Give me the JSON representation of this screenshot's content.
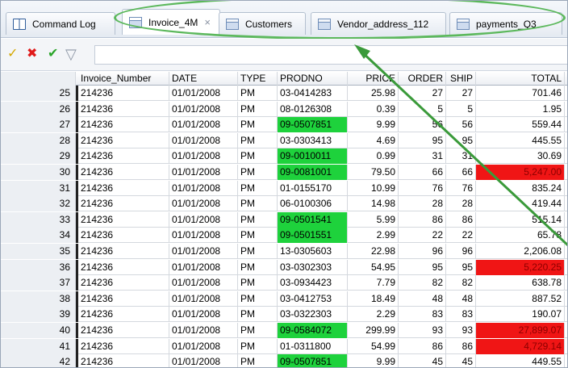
{
  "tabs": [
    {
      "label": "Command Log",
      "icon": "book-icon",
      "active": false
    },
    {
      "label": "Invoice_4M",
      "icon": "table-icon",
      "active": true,
      "close": "×"
    },
    {
      "label": "Customers",
      "icon": "table-icon",
      "active": false
    },
    {
      "label": "Vendor_address_112",
      "icon": "table-icon",
      "active": false
    },
    {
      "label": "payments_Q3",
      "icon": "table-icon",
      "active": false
    }
  ],
  "toolbar": {
    "icons": [
      "highlight-filter-icon",
      "delete-filter-icon",
      "apply-filter-icon",
      "funnel-icon"
    ],
    "filter_value": ""
  },
  "columns": [
    "Invoice_Number",
    "DATE",
    "TYPE",
    "PRODNO",
    "PRICE",
    "ORDER",
    "SHIP",
    "TOTAL"
  ],
  "rows": [
    {
      "n": "25",
      "inv": "214236",
      "date": "01/01/2008",
      "type": "PM",
      "prod": "03-0414283",
      "price": "25.98",
      "order": "27",
      "ship": "27",
      "total": "701.46",
      "prod_hl": false,
      "total_hl": false
    },
    {
      "n": "26",
      "inv": "214236",
      "date": "01/01/2008",
      "type": "PM",
      "prod": "08-0126308",
      "price": "0.39",
      "order": "5",
      "ship": "5",
      "total": "1.95",
      "prod_hl": false,
      "total_hl": false
    },
    {
      "n": "27",
      "inv": "214236",
      "date": "01/01/2008",
      "type": "PM",
      "prod": "09-0507851",
      "price": "9.99",
      "order": "56",
      "ship": "56",
      "total": "559.44",
      "prod_hl": true,
      "total_hl": false
    },
    {
      "n": "28",
      "inv": "214236",
      "date": "01/01/2008",
      "type": "PM",
      "prod": "03-0303413",
      "price": "4.69",
      "order": "95",
      "ship": "95",
      "total": "445.55",
      "prod_hl": false,
      "total_hl": false
    },
    {
      "n": "29",
      "inv": "214236",
      "date": "01/01/2008",
      "type": "PM",
      "prod": "09-0010011",
      "price": "0.99",
      "order": "31",
      "ship": "31",
      "total": "30.69",
      "prod_hl": true,
      "total_hl": false
    },
    {
      "n": "30",
      "inv": "214236",
      "date": "01/01/2008",
      "type": "PM",
      "prod": "09-0081001",
      "price": "79.50",
      "order": "66",
      "ship": "66",
      "total": "5,247.00",
      "prod_hl": true,
      "total_hl": true
    },
    {
      "n": "31",
      "inv": "214236",
      "date": "01/01/2008",
      "type": "PM",
      "prod": "01-0155170",
      "price": "10.99",
      "order": "76",
      "ship": "76",
      "total": "835.24",
      "prod_hl": false,
      "total_hl": false
    },
    {
      "n": "32",
      "inv": "214236",
      "date": "01/01/2008",
      "type": "PM",
      "prod": "06-0100306",
      "price": "14.98",
      "order": "28",
      "ship": "28",
      "total": "419.44",
      "prod_hl": false,
      "total_hl": false
    },
    {
      "n": "33",
      "inv": "214236",
      "date": "01/01/2008",
      "type": "PM",
      "prod": "09-0501541",
      "price": "5.99",
      "order": "86",
      "ship": "86",
      "total": "515.14",
      "prod_hl": true,
      "total_hl": false
    },
    {
      "n": "34",
      "inv": "214236",
      "date": "01/01/2008",
      "type": "PM",
      "prod": "09-0501551",
      "price": "2.99",
      "order": "22",
      "ship": "22",
      "total": "65.78",
      "prod_hl": true,
      "total_hl": false
    },
    {
      "n": "35",
      "inv": "214236",
      "date": "01/01/2008",
      "type": "PM",
      "prod": "13-0305603",
      "price": "22.98",
      "order": "96",
      "ship": "96",
      "total": "2,206.08",
      "prod_hl": false,
      "total_hl": false
    },
    {
      "n": "36",
      "inv": "214236",
      "date": "01/01/2008",
      "type": "PM",
      "prod": "03-0302303",
      "price": "54.95",
      "order": "95",
      "ship": "95",
      "total": "5,220.25",
      "prod_hl": false,
      "total_hl": true
    },
    {
      "n": "37",
      "inv": "214236",
      "date": "01/01/2008",
      "type": "PM",
      "prod": "03-0934423",
      "price": "7.79",
      "order": "82",
      "ship": "82",
      "total": "638.78",
      "prod_hl": false,
      "total_hl": false
    },
    {
      "n": "38",
      "inv": "214236",
      "date": "01/01/2008",
      "type": "PM",
      "prod": "03-0412753",
      "price": "18.49",
      "order": "48",
      "ship": "48",
      "total": "887.52",
      "prod_hl": false,
      "total_hl": false
    },
    {
      "n": "39",
      "inv": "214236",
      "date": "01/01/2008",
      "type": "PM",
      "prod": "03-0322303",
      "price": "2.29",
      "order": "83",
      "ship": "83",
      "total": "190.07",
      "prod_hl": false,
      "total_hl": false
    },
    {
      "n": "40",
      "inv": "214236",
      "date": "01/01/2008",
      "type": "PM",
      "prod": "09-0584072",
      "price": "299.99",
      "order": "93",
      "ship": "93",
      "total": "27,899.07",
      "prod_hl": true,
      "total_hl": true
    },
    {
      "n": "41",
      "inv": "214236",
      "date": "01/01/2008",
      "type": "PM",
      "prod": "01-0311800",
      "price": "54.99",
      "order": "86",
      "ship": "86",
      "total": "4,729.14",
      "prod_hl": false,
      "total_hl": true
    },
    {
      "n": "42",
      "inv": "214236",
      "date": "01/01/2008",
      "type": "PM",
      "prod": "09-0507851",
      "price": "9.99",
      "order": "45",
      "ship": "45",
      "total": "449.55",
      "prod_hl": true,
      "total_hl": false
    }
  ],
  "colors": {
    "green_highlight": "#1ed23c",
    "red_highlight": "#f01515",
    "annotation": "#5cb85c",
    "annotation_arrow": "#3a9a3a"
  }
}
